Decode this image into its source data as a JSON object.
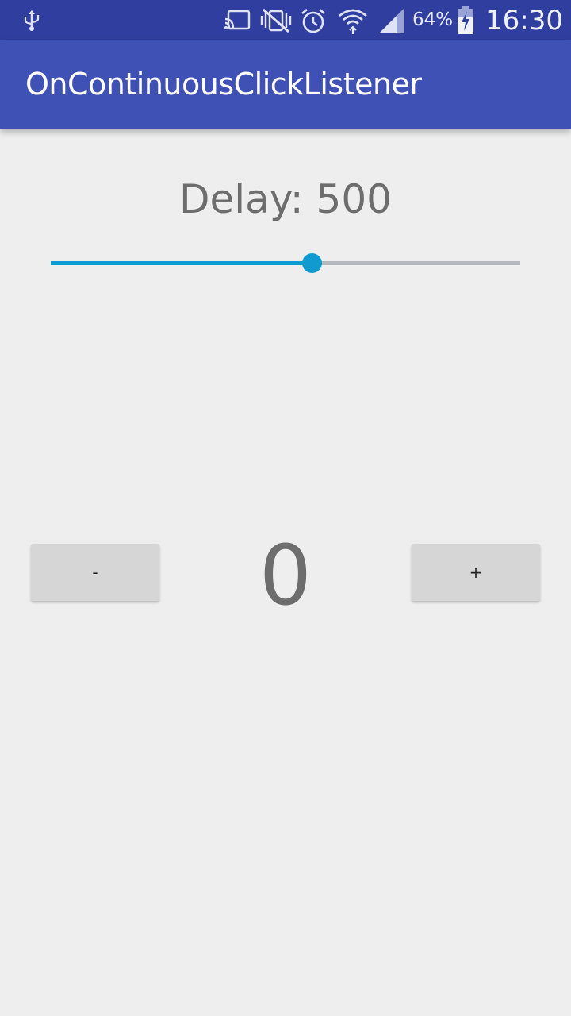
{
  "status_bar": {
    "icons": [
      "usb-icon",
      "cast-icon",
      "vibrate-mute-icon",
      "alarm-icon",
      "wifi-icon",
      "signal-icon",
      "battery-charging-icon"
    ],
    "battery_percent": "64%",
    "time": "16:30"
  },
  "app_bar": {
    "title": "OnContinuousClickListener"
  },
  "delay": {
    "label": "Delay: 500",
    "slider_fraction": 0.555
  },
  "counter": {
    "decrement_label": "-",
    "value": "0",
    "increment_label": "+"
  },
  "colors": {
    "status_bar": "#303f9f",
    "app_bar": "#3f51b5",
    "accent": "#0f9bd0",
    "background": "#eeeeee"
  }
}
